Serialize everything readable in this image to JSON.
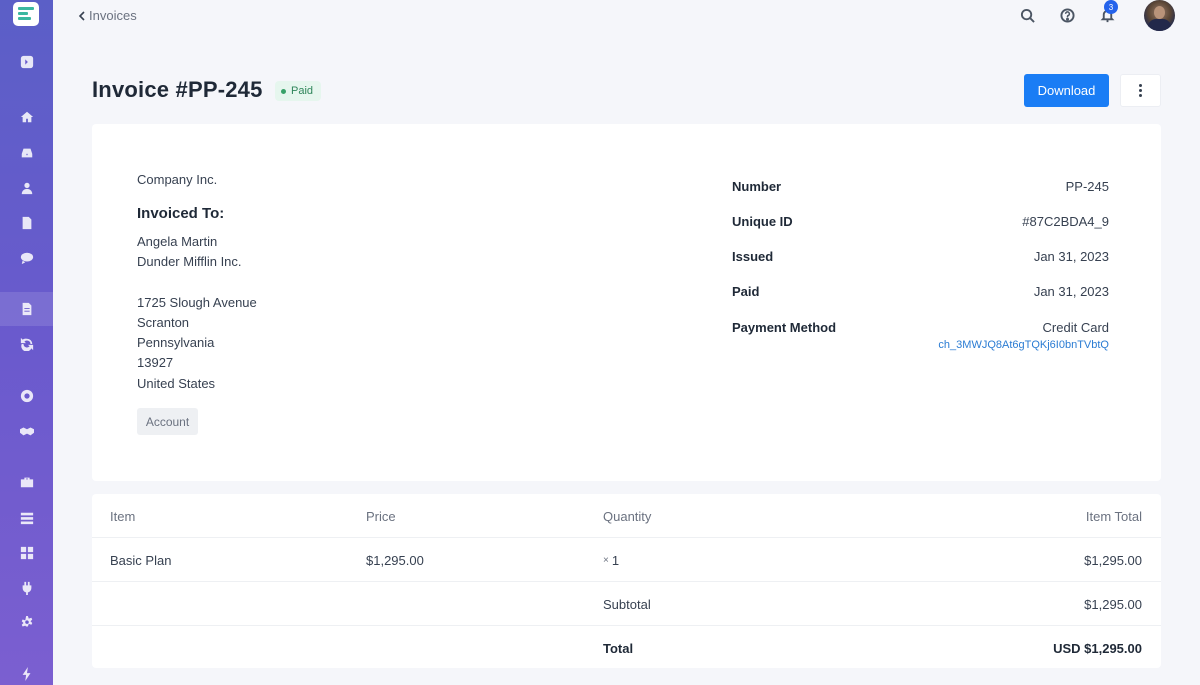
{
  "breadcrumb": {
    "label": "Invoices"
  },
  "header": {
    "notification_count": "3"
  },
  "invoice": {
    "title": "Invoice #PP-245",
    "status": "Paid",
    "download_label": "Download"
  },
  "billing": {
    "company": "Company Inc.",
    "invoiced_to_heading": "Invoiced To:",
    "name": "Angela Martin",
    "org": "Dunder Mifflin Inc.",
    "street": "1725 Slough Avenue",
    "city": "Scranton",
    "state": "Pennsylvania",
    "zip": "13927",
    "country": "United States",
    "account_label": "Account"
  },
  "meta": {
    "number_label": "Number",
    "number": "PP-245",
    "uid_label": "Unique ID",
    "uid": "#87C2BDA4_9",
    "issued_label": "Issued",
    "issued": "Jan 31, 2023",
    "paid_label": "Paid",
    "paid": "Jan 31, 2023",
    "method_label": "Payment Method",
    "method": "Credit Card",
    "charge_id": "ch_3MWJQ8At6gTQKj6I0bnTVbtQ"
  },
  "table": {
    "headers": [
      "Item",
      "Price",
      "Quantity",
      "Item Total"
    ],
    "rows": [
      {
        "item": "Basic Plan",
        "price": "$1,295.00",
        "qty_prefix": "×",
        "qty": "1",
        "total": "$1,295.00"
      }
    ],
    "subtotal_label": "Subtotal",
    "subtotal": "$1,295.00",
    "total_label": "Total",
    "total": "USD $1,295.00"
  },
  "colors": {
    "accent": "#1a7df5",
    "sidebar": "#6a5acd",
    "paid_badge_bg": "#e6f6ee",
    "link": "#2b7cd3"
  },
  "icons": {
    "sidebar": [
      "logo",
      "login-icon",
      "home-icon",
      "inbox-icon",
      "user-icon",
      "file-icon",
      "chat-icon",
      "invoice-icon",
      "refresh-icon",
      "gear-circle-icon",
      "handshake-icon",
      "briefcase-icon",
      "list-icon",
      "grid-icon",
      "plug-icon",
      "settings-icon",
      "bolt-icon"
    ],
    "top": [
      "search-icon",
      "help-icon",
      "bell-icon",
      "avatar"
    ]
  }
}
